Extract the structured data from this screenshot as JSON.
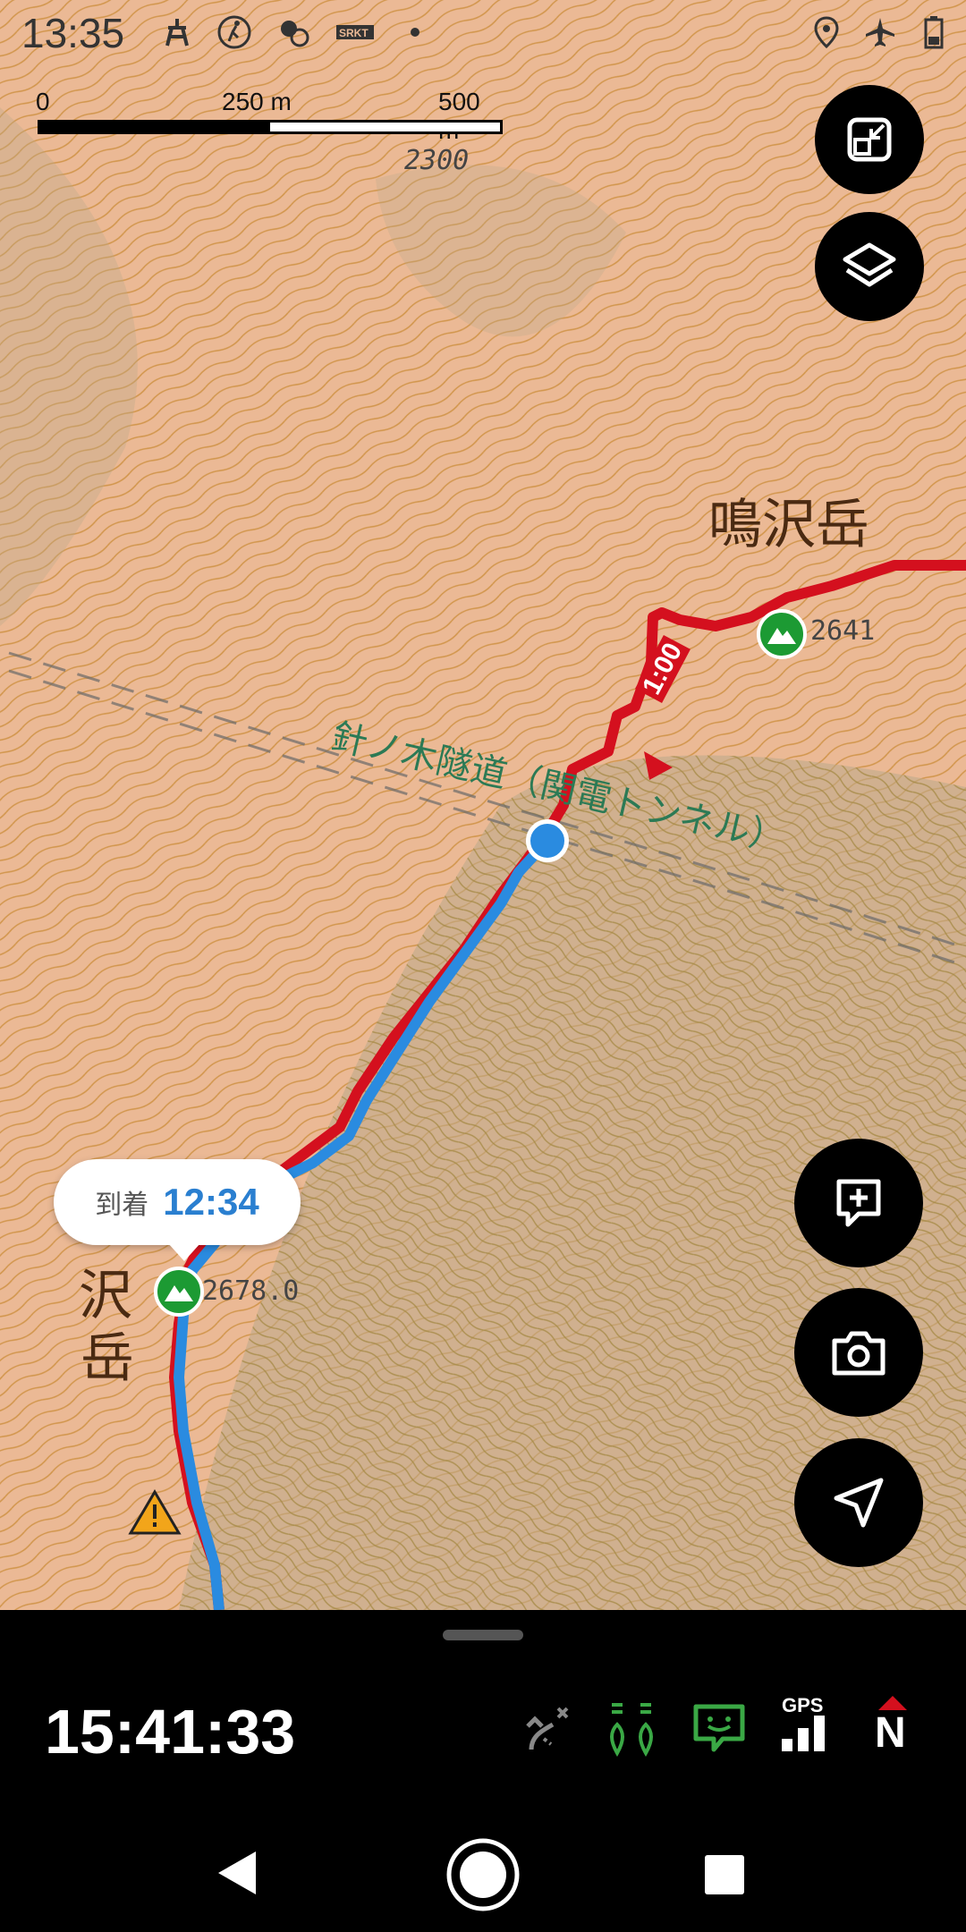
{
  "status_bar": {
    "time": "13:35",
    "icons": [
      "tower-icon",
      "hiking-icon",
      "weather-icon",
      "sr-icon",
      "dot-icon",
      "location-icon",
      "airplane-icon",
      "battery-icon"
    ]
  },
  "scale_bar": {
    "label_0": "0",
    "label_mid": "250 m",
    "label_end": "500 m"
  },
  "map": {
    "peak_label_top": "鳴沢岳",
    "peak_label_left_1": "沢",
    "peak_label_left_2": "岳",
    "elevation_top": "2641",
    "elevation_left": "2678.0",
    "contour_label": "2300",
    "tunnel_label": "針ノ木隧道（関電トンネル）",
    "route_time": "1:00",
    "colors": {
      "route_red": "#d4101e",
      "track_blue": "#2a8be0",
      "peak_green": "#1c9a33",
      "map_bg": "#ebb995"
    }
  },
  "arrival": {
    "label": "到着",
    "time": "12:34"
  },
  "fab": [
    "fullscreen-exit-icon",
    "layers-icon",
    "add-note-icon",
    "camera-icon",
    "navigate-icon"
  ],
  "bottom_panel": {
    "clock": "15:41:33",
    "gps_label": "GPS",
    "compass_label": "N",
    "icons": [
      "route-off-icon",
      "companions-icon",
      "message-icon",
      "gps-signal-icon",
      "compass-icon"
    ]
  },
  "nav_bar": [
    "back-button",
    "home-button",
    "recents-button"
  ]
}
